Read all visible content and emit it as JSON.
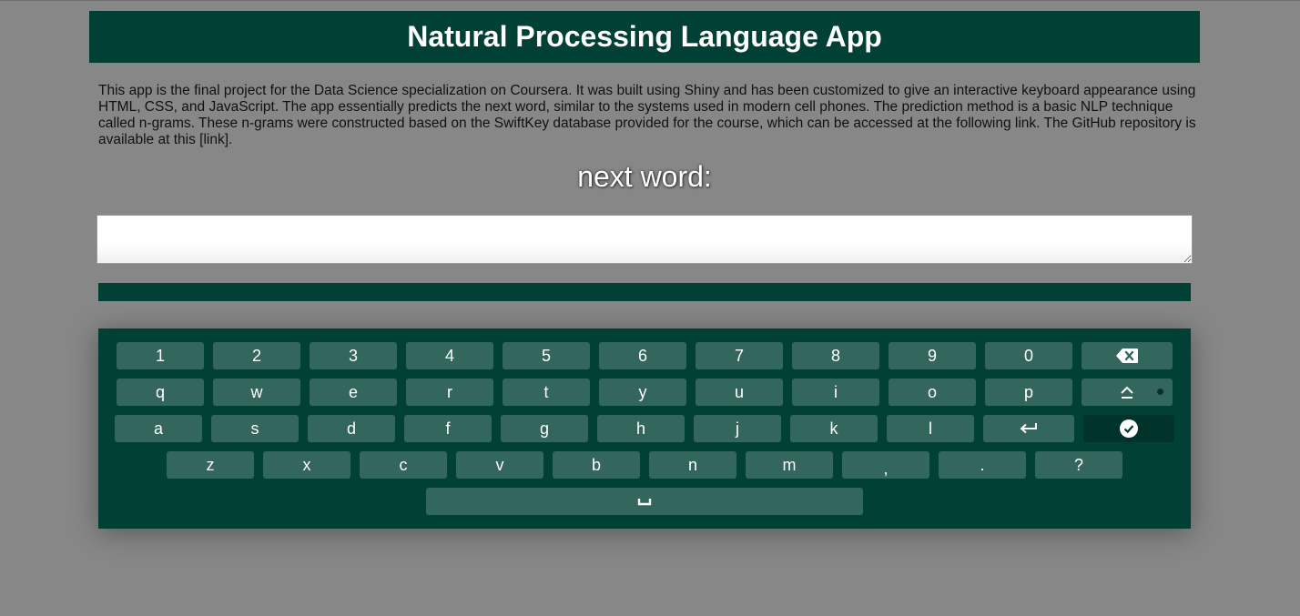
{
  "header": {
    "title": "Natural Processing Language App"
  },
  "description": "This app is the final project for the Data Science specialization on Coursera. It was built using Shiny and has been customized to give an interactive keyboard appearance using HTML, CSS, and JavaScript. The app essentially predicts the next word, similar to the systems used in modern cell phones. The prediction method is a basic NLP technique called n-grams. These n-grams were constructed based on the SwiftKey database provided for the course, which can be accessed at the following link. The GitHub repository is available at this [link].",
  "next_word_label": "next word:",
  "input": {
    "value": "",
    "placeholder": ""
  },
  "keyboard": {
    "row1": [
      "1",
      "2",
      "3",
      "4",
      "5",
      "6",
      "7",
      "8",
      "9",
      "0"
    ],
    "row2": [
      "q",
      "w",
      "e",
      "r",
      "t",
      "y",
      "u",
      "i",
      "o",
      "p"
    ],
    "row3": [
      "a",
      "s",
      "d",
      "f",
      "g",
      "h",
      "j",
      "k",
      "l"
    ],
    "row4": [
      "z",
      "x",
      "c",
      "v",
      "b",
      "n",
      "m",
      ",",
      ".",
      "?"
    ],
    "backspace_icon": "backspace-icon",
    "shift_icon": "shift-icon",
    "enter_icon": "enter-icon",
    "accept_icon": "check-circle-icon",
    "space_icon": "space-bar-icon"
  },
  "colors": {
    "brand": "#004035",
    "key": "#33665c",
    "key_dark": "#00332a",
    "background": "#878787"
  }
}
